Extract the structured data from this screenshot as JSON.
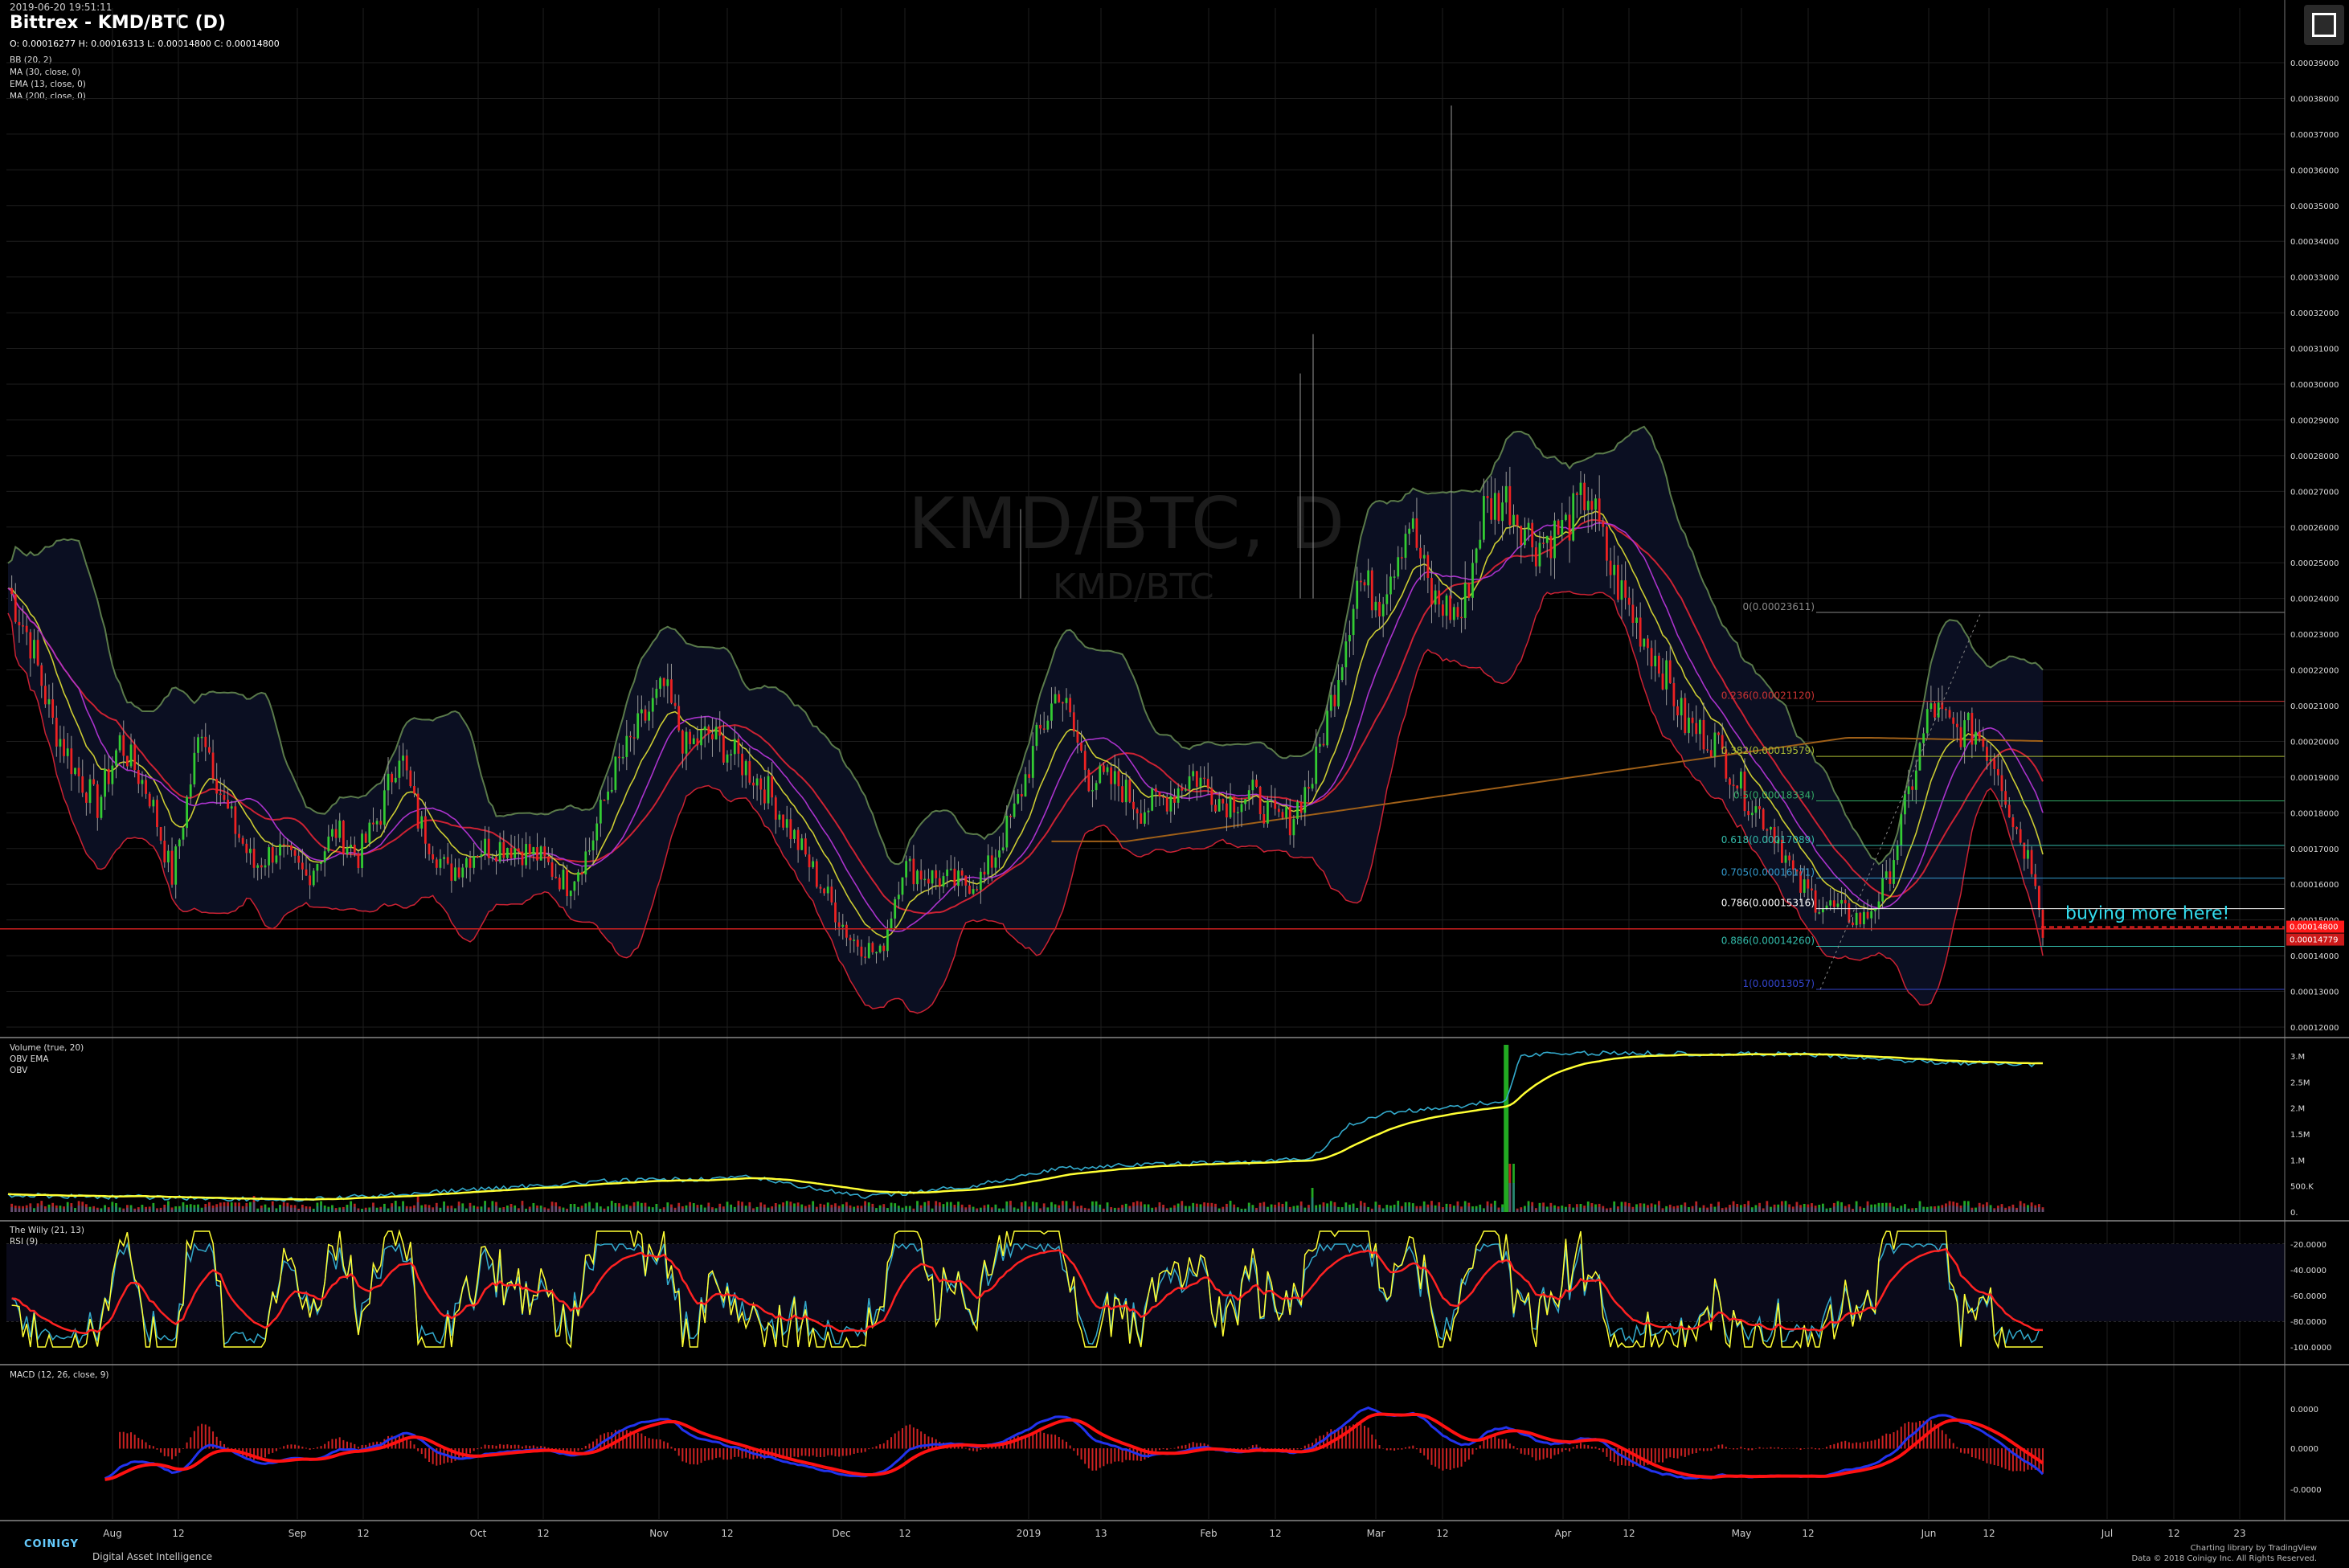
{
  "header": {
    "timestamp": "2019-06-20 19:51:11",
    "title": "Bittrex - KMD/BTC (D)",
    "ohlc": "O: 0.00016277 H: 0.00016313 L: 0.00014800 C: 0.00014800",
    "indicators": [
      "BB (20, 2)",
      "MA (30, close, 0)",
      "EMA (13, close, 0)",
      "MA (200, close, 0)"
    ]
  },
  "watermark": {
    "main": "KMD/BTC, D",
    "sub": "KMD/BTC"
  },
  "colors": {
    "up": "#33cc33",
    "down": "#ee2222",
    "bb": "#5a7a4a",
    "ma30": "#cc2233",
    "ema13": "#cccc33",
    "ma200": "#a06018",
    "obv": "#33aacc",
    "obv_ema": "#ffff33",
    "rsi": "#ffff33",
    "willy": "#33aacc",
    "willy_ema": "#ff2222",
    "macd": "#2233ee",
    "signal": "#ff1111",
    "hist": "#cc2222"
  },
  "panes": {
    "volume": [
      "Volume (true, 20)",
      "OBV EMA",
      "OBV"
    ],
    "willy": [
      "The Willy (21, 13)",
      "RSI (9)"
    ],
    "macd": [
      "MACD (12, 26, close, 9)"
    ]
  },
  "annotation": "buying more here!",
  "price_tags": [
    "0.00014800",
    "0.00014779"
  ],
  "fib_levels": [
    {
      "label": "0(0.00023611)",
      "value": 0.00023611,
      "color": "#888888"
    },
    {
      "label": "0.236(0.00021120)",
      "value": 0.0002112,
      "color": "#cc3333"
    },
    {
      "label": "0.382(0.00019579)",
      "value": 0.00019579,
      "color": "#aabb33"
    },
    {
      "label": "0.5(0.00018334)",
      "value": 0.00018334,
      "color": "#33aa66"
    },
    {
      "label": "0.618(0.00017089)",
      "value": 0.00017089,
      "color": "#33bbaa"
    },
    {
      "label": "0.705(0.00016171)",
      "value": 0.00016171,
      "color": "#3399cc"
    },
    {
      "label": "0.786(0.00015316)",
      "value": 0.00015316,
      "color": "#ffffff"
    },
    {
      "label": "0.886(0.00014260)",
      "value": 0.0001426,
      "color": "#33bbaa"
    },
    {
      "label": "1(0.00013057)",
      "value": 0.00013057,
      "color": "#3344cc"
    }
  ],
  "axis": {
    "price_ticks": [
      "0.00039000",
      "0.00038000",
      "0.00037000",
      "0.00036000",
      "0.00035000",
      "0.00034000",
      "0.00033000",
      "0.00032000",
      "0.00031000",
      "0.00030000",
      "0.00029000",
      "0.00028000",
      "0.00027000",
      "0.00026000",
      "0.00025000",
      "0.00024000",
      "0.00023000",
      "0.00022000",
      "0.00021000",
      "0.00020000",
      "0.00019000",
      "0.00018000",
      "0.00017000",
      "0.00016000",
      "0.00015000",
      "0.00014000",
      "0.00013000",
      "0.00012000"
    ],
    "volume_ticks": [
      "3.M",
      "2.5M",
      "2.M",
      "1.5M",
      "1.M",
      "500.K",
      "0."
    ],
    "willy_ticks": [
      "-20.0000",
      "-40.0000",
      "-60.0000",
      "-80.0000",
      "-100.0000"
    ],
    "macd_ticks": [
      "0.0000",
      "0.0000",
      "-0.0000"
    ],
    "time_ticks": [
      "Aug",
      "12",
      "Sep",
      "12",
      "Oct",
      "12",
      "Nov",
      "12",
      "Dec",
      "12",
      "2019",
      "13",
      "Feb",
      "12",
      "Mar",
      "12",
      "Apr",
      "12",
      "May",
      "12",
      "Jun",
      "12",
      "Jul",
      "12",
      "23"
    ]
  },
  "chart_data": {
    "type": "candlestick",
    "title": "Bittrex - KMD/BTC (D)",
    "ylim": [
      0.00012,
      0.00039
    ],
    "price_path": [
      [
        0,
        0.000243
      ],
      [
        6,
        0.000228
      ],
      [
        12,
        0.000205
      ],
      [
        18,
        0.000192
      ],
      [
        24,
        0.000182
      ],
      [
        30,
        0.0002
      ],
      [
        38,
        0.000185
      ],
      [
        44,
        0.000162
      ],
      [
        52,
        0.000205
      ],
      [
        58,
        0.000182
      ],
      [
        66,
        0.000165
      ],
      [
        72,
        0.00017
      ],
      [
        80,
        0.000162
      ],
      [
        88,
        0.000175
      ],
      [
        94,
        0.000168
      ],
      [
        100,
        0.00018
      ],
      [
        105,
        0.000198
      ],
      [
        110,
        0.000178
      ],
      [
        118,
        0.000163
      ],
      [
        126,
        0.00017
      ],
      [
        134,
        0.000171
      ],
      [
        142,
        0.000168
      ],
      [
        150,
        0.00016
      ],
      [
        156,
        0.00017
      ],
      [
        162,
        0.00019
      ],
      [
        170,
        0.000205
      ],
      [
        176,
        0.000215
      ],
      [
        182,
        0.000198
      ],
      [
        188,
        0.000202
      ],
      [
        196,
        0.000195
      ],
      [
        204,
        0.000186
      ],
      [
        210,
        0.000175
      ],
      [
        218,
        0.00016
      ],
      [
        226,
        0.000145
      ],
      [
        234,
        0.00014
      ],
      [
        240,
        0.000165
      ],
      [
        248,
        0.000162
      ],
      [
        256,
        0.00016
      ],
      [
        262,
        0.000162
      ],
      [
        270,
        0.00018
      ],
      [
        276,
        0.0002
      ],
      [
        282,
        0.000215
      ],
      [
        290,
        0.00019
      ],
      [
        298,
        0.000188
      ],
      [
        304,
        0.000181
      ],
      [
        312,
        0.000185
      ],
      [
        318,
        0.000191
      ],
      [
        326,
        0.000183
      ],
      [
        334,
        0.000185
      ],
      [
        340,
        0.000178
      ],
      [
        344,
        0.000178
      ],
      [
        350,
        0.00019
      ],
      [
        356,
        0.000215
      ],
      [
        362,
        0.000245
      ],
      [
        368,
        0.00024
      ],
      [
        376,
        0.000262
      ],
      [
        382,
        0.00024
      ],
      [
        390,
        0.000235
      ],
      [
        396,
        0.000265
      ],
      [
        402,
        0.000268
      ],
      [
        410,
        0.000255
      ],
      [
        418,
        0.00026
      ],
      [
        424,
        0.00027
      ],
      [
        430,
        0.000248
      ],
      [
        436,
        0.000235
      ],
      [
        444,
        0.00022
      ],
      [
        450,
        0.000205
      ],
      [
        458,
        0.0002
      ],
      [
        466,
        0.000185
      ],
      [
        474,
        0.000175
      ],
      [
        480,
        0.00016
      ],
      [
        486,
        0.000155
      ],
      [
        492,
        0.000152
      ],
      [
        498,
        0.00015
      ],
      [
        504,
        0.00016
      ],
      [
        510,
        0.000185
      ],
      [
        516,
        0.00021
      ],
      [
        522,
        0.000203
      ],
      [
        528,
        0.000203
      ],
      [
        534,
        0.000193
      ],
      [
        538,
        0.000178
      ],
      [
        544,
        0.000163
      ],
      [
        546,
        0.000148
      ]
    ],
    "series": [
      {
        "name": "MA (200, close, 0)"
      },
      {
        "name": "EMA (13, close, 0)"
      },
      {
        "name": "MA (30, close, 0)"
      },
      {
        "name": "BB (20, 2)"
      }
    ]
  },
  "footer": {
    "brand": "COINIGY",
    "tagline": "Digital Asset Intelligence",
    "credit1": "Charting library by  TradingView",
    "credit2": "Data © 2018  Coinigy Inc. All Rights Reserved."
  }
}
